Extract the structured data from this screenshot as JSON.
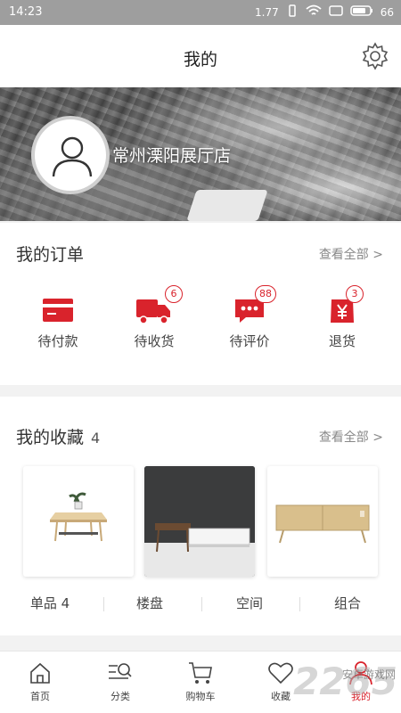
{
  "status_bar": {
    "time": "14:23",
    "speed": "1.77",
    "battery": "66"
  },
  "header": {
    "title": "我的"
  },
  "profile": {
    "store_name": "常州溧阳展厅店"
  },
  "orders": {
    "title": "我的订单",
    "view_all": "查看全部 >",
    "items": [
      {
        "label": "待付款",
        "icon": "card-icon",
        "badge": ""
      },
      {
        "label": "待收货",
        "icon": "truck-icon",
        "badge": "6"
      },
      {
        "label": "待评价",
        "icon": "comment-icon",
        "badge": "88"
      },
      {
        "label": "退货",
        "icon": "yen-bag-icon",
        "badge": "3"
      }
    ]
  },
  "favorites": {
    "title": "我的收藏",
    "count": "4",
    "view_all": "查看全部 >",
    "tabs": [
      {
        "label": "单品 4"
      },
      {
        "label": "楼盘"
      },
      {
        "label": "空间"
      },
      {
        "label": "组合"
      }
    ]
  },
  "bottom_nav": [
    {
      "label": "首页",
      "icon": "home-icon"
    },
    {
      "label": "分类",
      "icon": "category-search-icon"
    },
    {
      "label": "购物车",
      "icon": "cart-icon"
    },
    {
      "label": "收藏",
      "icon": "heart-icon"
    },
    {
      "label": "我的",
      "icon": "person-icon",
      "active": true
    }
  ],
  "watermark": {
    "text": "2265",
    "sub": "安卓游戏网"
  },
  "colors": {
    "accent": "#d9232c",
    "status_bar": "#9e9e9e"
  }
}
